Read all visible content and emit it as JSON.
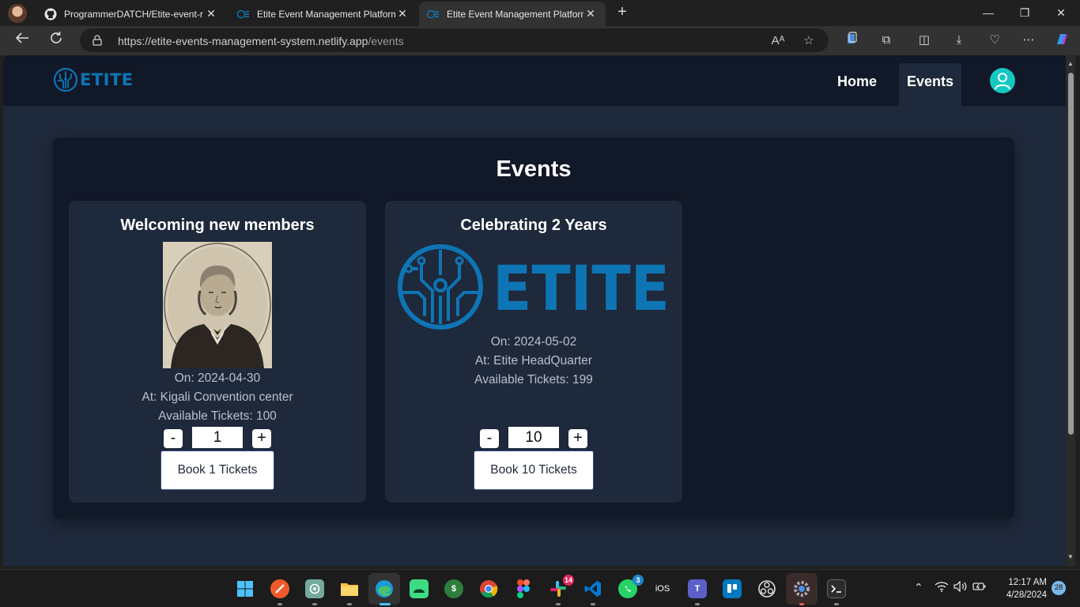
{
  "browser": {
    "tabs": [
      {
        "title": "ProgrammerDATCH/Etite-event-r",
        "icon": "github-icon",
        "active": false
      },
      {
        "title": "Etite Event Management Platform",
        "icon": "etite-favicon",
        "active": false
      },
      {
        "title": "Etite Event Management Platform",
        "icon": "etite-favicon",
        "active": true
      }
    ],
    "new_tab": "+",
    "url_host": "https://etite-events-management-system.netlify.app",
    "url_path": "/events"
  },
  "site": {
    "logo_text": "ETITE",
    "nav": {
      "home": "Home",
      "events": "Events"
    },
    "active_nav": "Events"
  },
  "events_page": {
    "title": "Events",
    "events": [
      {
        "title": "Welcoming new members",
        "image": "portrait-photo",
        "date": "On: 2024-04-30",
        "location": "At: Kigali Convention center",
        "tickets": "Available Tickets: 100",
        "minus": "-",
        "plus": "+",
        "quantity": "1",
        "book_label": "Book 1 Tickets"
      },
      {
        "title": "Celebrating 2 Years",
        "image": "etite-logo",
        "logo_text": "ETITE",
        "date": "On: 2024-05-02",
        "location": "At: Etite HeadQuarter",
        "tickets": "Available Tickets: 199",
        "minus": "-",
        "plus": "+",
        "quantity": "10",
        "book_label": "Book 10 Tickets"
      }
    ]
  },
  "taskbar": {
    "ios_label": "iOS",
    "badges": {
      "slack": "14",
      "whatsapp": "3"
    },
    "time": "12:17 AM",
    "date": "4/28/2024",
    "notifications": "28"
  },
  "colors": {
    "header_bg": "#111827",
    "page_bg": "#1e293b",
    "brand_blue": "#0e75b5",
    "avatar": "#14c8c2"
  }
}
